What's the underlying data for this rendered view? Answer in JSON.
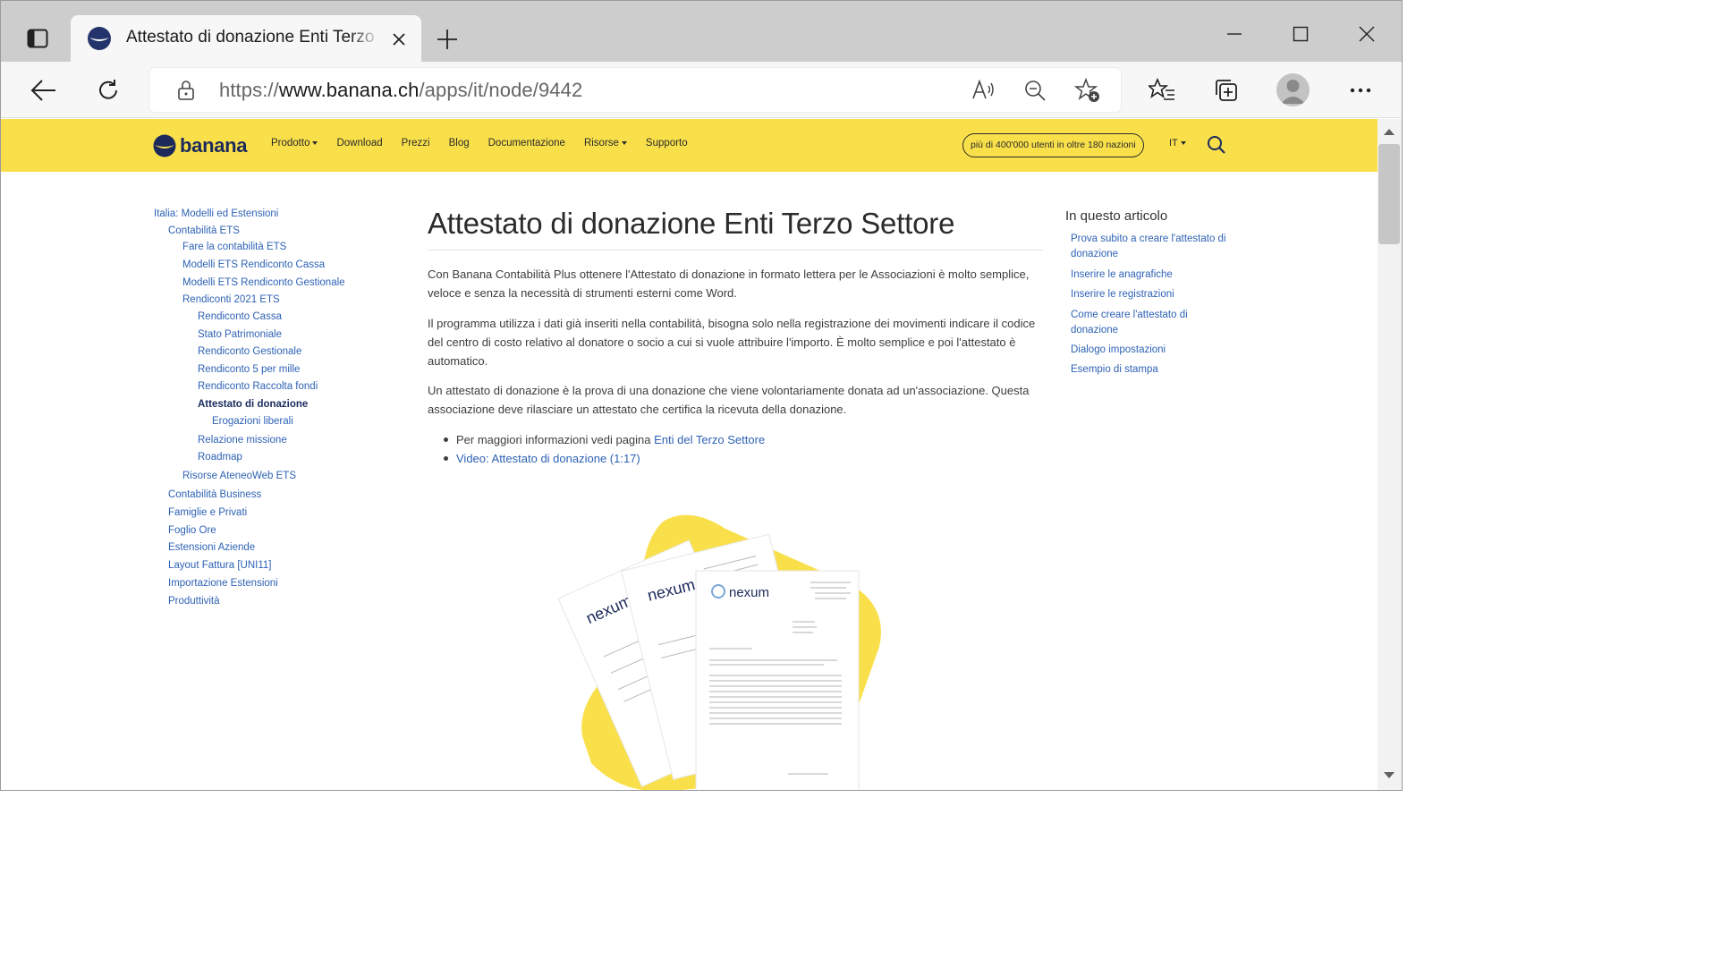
{
  "browser": {
    "tab": {
      "title": "Attestato di donazione Enti Terzo Settore"
    },
    "address": {
      "scheme": "https://",
      "host": "www.banana.ch",
      "path": "/apps/it/node/9442"
    }
  },
  "site": {
    "logo_text": "banana",
    "nav": [
      "Prodotto",
      "Download",
      "Prezzi",
      "Blog",
      "Documentazione",
      "Risorse",
      "Supporto"
    ],
    "users_badge": "più di 400'000 utenti in oltre 180 nazioni",
    "language": "IT"
  },
  "leftnav": [
    "Italia: Modelli ed Estensioni",
    "Contabilità ETS",
    "Fare la contabilità ETS",
    "Modelli ETS Rendiconto Cassa",
    "Modelli ETS Rendiconto Gestionale",
    "Rendiconti 2021 ETS",
    "Rendiconto Cassa",
    "Stato Patrimoniale",
    "Rendiconto Gestionale",
    "Rendiconto 5 per mille",
    "Rendiconto Raccolta fondi",
    "Attestato di donazione",
    "Erogazioni liberali",
    "Relazione missione",
    "Roadmap",
    "Risorse AteneoWeb ETS",
    "Contabilità Business",
    "Famiglie e Privati",
    "Foglio Ore",
    "Estensioni Aziende",
    "Layout Fattura [UNI11]",
    "Importazione Estensioni",
    "Produttività"
  ],
  "article": {
    "title": "Attestato di donazione Enti Terzo Settore",
    "p1": "Con Banana Contabilità Plus ottenere l'Attestato di donazione in formato lettera per le Associazioni è molto semplice, veloce e senza la necessità di strumenti esterni come Word.",
    "p2": "Il programma utilizza i dati già inseriti nella contabilità, bisogna solo nella registrazione dei movimenti indicare il codice del centro di costo relativo al donatore o socio a cui si vuole attribuire l'importo. È molto semplice e poi l'attestato è automatico.",
    "p3": "Un attestato di donazione è la prova di una donazione che viene volontariamente donata ad un'associazione. Questa associazione deve rilasciare un attestato che certifica la ricevuta della donazione.",
    "bullet1_text": "Per maggiori informazioni vedi pagina ",
    "bullet1_link": "Enti del Terzo Settore",
    "bullet2_link": "Video: Attestato di donazione (1:17)",
    "doc_brand": "nexum"
  },
  "toc": {
    "title": "In questo articolo",
    "items": [
      "Prova subito a creare l'attestato di donazione",
      "Inserire le anagrafiche",
      "Inserire le registrazioni",
      "Come creare l'attestato di donazione",
      "Dialogo impostazioni",
      "Esempio di stampa"
    ]
  },
  "colors": {
    "header": "#f9e04b",
    "link": "#2e62b5",
    "brand_navy": "#1c2a5b"
  }
}
